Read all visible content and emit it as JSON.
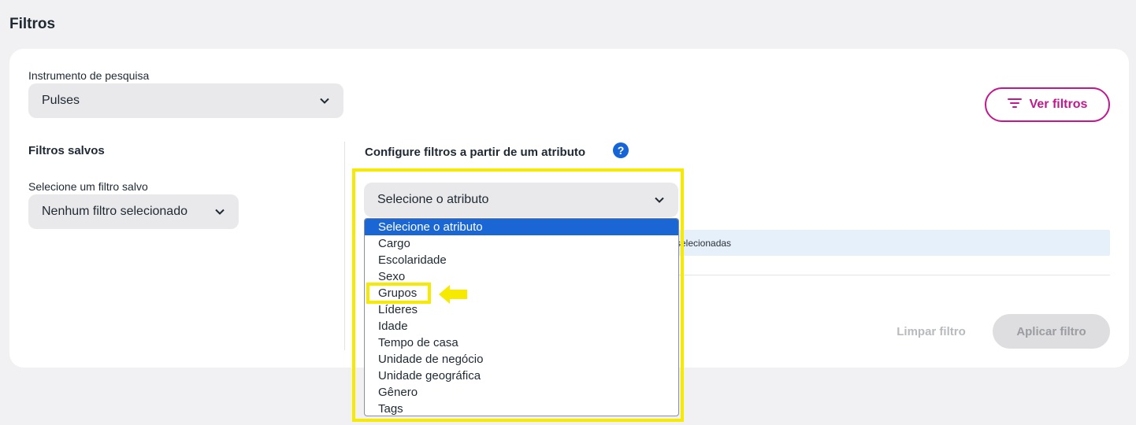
{
  "page": {
    "title": "Filtros"
  },
  "instrument": {
    "label": "Instrumento de pesquisa",
    "value": "Pulses"
  },
  "saved_filters": {
    "title": "Filtros salvos",
    "label": "Selecione um filtro salvo",
    "value": "Nenhum filtro selecionado"
  },
  "configure": {
    "title": "Configure filtros a partir de um atributo",
    "help_glyph": "?",
    "attribute_select": {
      "value": "Selecione o atributo",
      "options": [
        "Selecione o atributo",
        "Cargo",
        "Escolaridade",
        "Sexo",
        "Grupos",
        "Líderes",
        "Idade",
        "Tempo de casa",
        "Unidade de negócio",
        "Unidade geográfica",
        "Gênero",
        "Tags"
      ],
      "selected_index": 0,
      "highlighted_option": "Grupos"
    }
  },
  "info_bar": {
    "text": "selecionadas"
  },
  "actions": {
    "ver_filtros": "Ver filtros",
    "limpar": "Limpar filtro",
    "aplicar": "Aplicar filtro"
  },
  "colors": {
    "accent": "#c2188f",
    "selection": "#1a66d4",
    "highlight": "#f6ea00",
    "help": "#1565d8"
  },
  "icons": {
    "ver_filtros": "filter-lines-icon",
    "help": "help-icon",
    "chevron": "chevron-down-icon",
    "annotation": "arrow-left-icon"
  }
}
